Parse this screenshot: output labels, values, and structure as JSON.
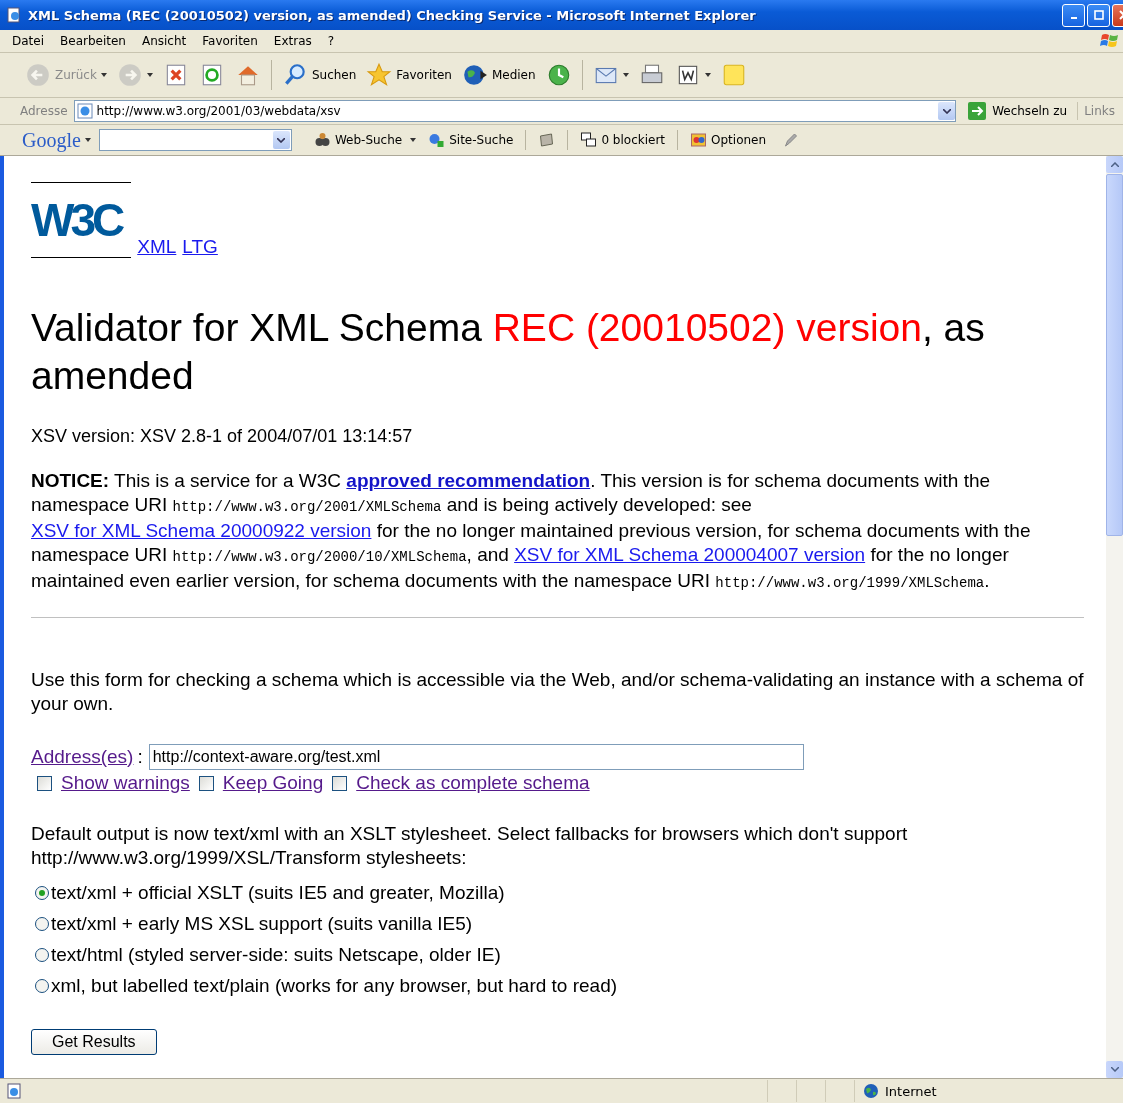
{
  "window": {
    "title": "XML Schema (REC (20010502) version, as amended) Checking Service - Microsoft Internet Explorer"
  },
  "menu": [
    "Datei",
    "Bearbeiten",
    "Ansicht",
    "Favoriten",
    "Extras",
    "?"
  ],
  "toolbar": [
    {
      "kind": "back",
      "label": "Zurück",
      "disabled": true,
      "has_menu": true
    },
    {
      "kind": "forward",
      "disabled": true,
      "has_menu": true
    },
    {
      "kind": "stop",
      "disabled": false,
      "has_menu": false
    },
    {
      "kind": "refresh",
      "disabled": false,
      "has_menu": false
    },
    {
      "kind": "home",
      "disabled": false,
      "has_menu": false
    },
    {
      "kind": "search",
      "label": "Suchen",
      "disabled": false,
      "has_menu": false
    },
    {
      "kind": "favorites",
      "label": "Favoriten",
      "disabled": false,
      "has_menu": false
    },
    {
      "kind": "media",
      "label": "Medien",
      "disabled": false,
      "has_menu": false
    },
    {
      "kind": "history",
      "disabled": false,
      "has_menu": false
    },
    {
      "kind": "mail",
      "disabled": false,
      "has_menu": true
    },
    {
      "kind": "print",
      "disabled": false,
      "has_menu": false
    },
    {
      "kind": "edit",
      "disabled": false,
      "has_menu": true
    },
    {
      "kind": "note",
      "disabled": false,
      "has_menu": false
    }
  ],
  "address_bar": {
    "label": "Adresse",
    "value": "http://www.w3.org/2001/03/webdata/xsv",
    "go": "Wechseln zu",
    "links": "Links"
  },
  "google_bar": {
    "logo": "Google",
    "items": [
      {
        "kind": "web",
        "label": "Web-Suche"
      },
      {
        "kind": "site",
        "label": "Site-Suche"
      },
      {
        "kind": "news"
      },
      {
        "kind": "popup",
        "label": "0 blockiert"
      },
      {
        "kind": "options",
        "label": "Optionen"
      },
      {
        "kind": "highlight"
      }
    ]
  },
  "page": {
    "logo": "W3C",
    "logo_links": [
      "XML",
      "LTG"
    ],
    "heading": [
      {
        "kind": "text",
        "text": "Validator for XML Schema "
      },
      {
        "kind": "red",
        "text": "REC (20010502) version"
      },
      {
        "kind": "text",
        "text": ", as amended"
      }
    ],
    "version": "XSV version: XSV 2.8-1 of 2004/07/01 13:14:57",
    "notice": [
      {
        "kind": "bold",
        "text": "NOTICE:"
      },
      {
        "kind": "text",
        "text": " This is a service for a W3C "
      },
      {
        "kind": "strong_link",
        "text": "approved recommendation"
      },
      {
        "kind": "text",
        "text": ". This version is for schema documents with the namespace URI "
      },
      {
        "kind": "code",
        "text": "http://www.w3.org/2001/XMLSchema"
      },
      {
        "kind": "text",
        "text": " and is being actively developed: see "
      },
      {
        "kind": "link",
        "text": "XSV for XML Schema 20000922 version"
      },
      {
        "kind": "text",
        "text": " for the no longer maintained previous version, for schema documents with the namespace URI "
      },
      {
        "kind": "code",
        "text": "http://www.w3.org/2000/10/XMLSchema"
      },
      {
        "kind": "text",
        "text": ", and "
      },
      {
        "kind": "link",
        "text": "XSV for XML Schema 200004007 version"
      },
      {
        "kind": "text",
        "text": " for the no longer maintained even earlier version, for schema documents with the namespace URI "
      },
      {
        "kind": "code",
        "text": "http://www.w3.org/1999/XMLSchema"
      },
      {
        "kind": "text",
        "text": "."
      }
    ],
    "intro": "Use this form for checking a schema which is accessible via the Web, and/or schema-validating an instance with a schema of your own.",
    "address_label": "Address(es)",
    "address_suffix": ":",
    "address_value": "http://context-aware.org/test.xml",
    "options": [
      {
        "label": "Show warnings",
        "checked": false
      },
      {
        "label": "Keep Going",
        "checked": false
      },
      {
        "label": "Check as complete schema",
        "checked": false
      }
    ],
    "output_text": "Default output is now text/xml with an XSLT stylesheet. Select fallbacks for browsers which don't support http://www.w3.org/1999/XSL/Transform stylesheets:",
    "outputs": [
      {
        "label": "text/xml + official XSLT (suits IE5 and greater, Mozilla)",
        "selected": true
      },
      {
        "label": "text/xml + early MS XSL support (suits vanilla IE5)",
        "selected": false
      },
      {
        "label": "text/html (styled server-side: suits Netscape, older IE)",
        "selected": false
      },
      {
        "label": "xml, but labelled text/plain (works for any browser, but hard to read)",
        "selected": false
      }
    ],
    "submit": "Get Results"
  },
  "status_bar": {
    "zone": "Internet"
  }
}
